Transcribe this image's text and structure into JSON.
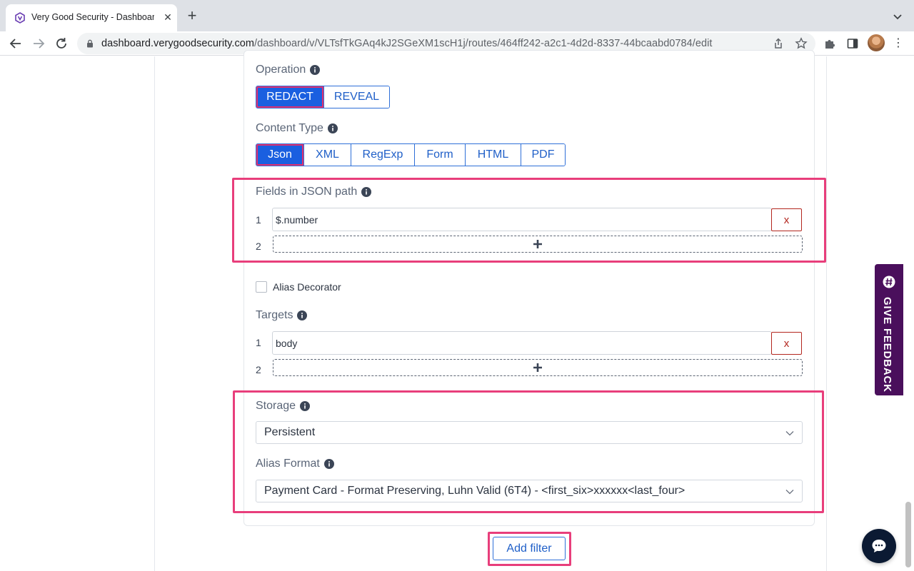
{
  "browser": {
    "tab_title": "Very Good Security - Dashboard",
    "tab_close": "✕",
    "new_tab": "+",
    "url_host": "dashboard.verygoodsecurity.com",
    "url_path": "/dashboard/v/VLTsfTkGAq4kJ2SGeXM1scH1j/routes/464ff242-a2c1-4d2d-8337-44bcaabd0784/edit",
    "menu": "⋮"
  },
  "operation": {
    "label": "Operation",
    "options": [
      "REDACT",
      "REVEAL"
    ],
    "selected": "REDACT"
  },
  "content_type": {
    "label": "Content Type",
    "options": [
      "Json",
      "XML",
      "RegExp",
      "Form",
      "HTML",
      "PDF"
    ],
    "selected": "Json"
  },
  "fields": {
    "label": "Fields in JSON path",
    "rows": [
      {
        "num": "1",
        "value": "$.number",
        "remove": "x"
      },
      {
        "num": "2"
      }
    ]
  },
  "alias_decorator": {
    "label": "Alias Decorator",
    "checked": false
  },
  "targets": {
    "label": "Targets",
    "rows": [
      {
        "num": "1",
        "value": "body",
        "remove": "x"
      },
      {
        "num": "2"
      }
    ]
  },
  "storage": {
    "label": "Storage",
    "value": "Persistent"
  },
  "alias_format": {
    "label": "Alias Format",
    "value": "Payment Card - Format Preserving, Luhn Valid (6T4) - <first_six>xxxxxx<last_four>"
  },
  "add_filter": "Add filter",
  "feedback": "GIVE FEEDBACK",
  "colors": {
    "primary": "#1a5fe0",
    "highlight": "#e83e7b",
    "feedback_bg": "#4a0f5c",
    "danger": "#b3261e"
  }
}
